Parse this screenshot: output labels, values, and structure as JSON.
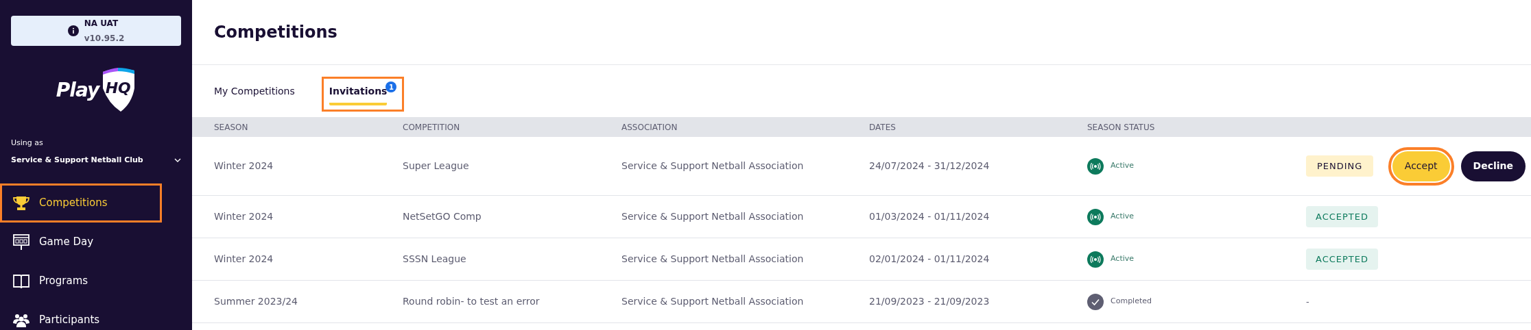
{
  "sidebar": {
    "env": {
      "name": "NA UAT",
      "version": "v10.95.2"
    },
    "logo": {
      "word": "Play",
      "mark": "HQ"
    },
    "using_as": {
      "label": "Using as",
      "org": "Service & Support Netball Club"
    },
    "items": [
      {
        "label": "Competitions",
        "selected": true,
        "highlighted": true
      },
      {
        "label": "Game Day",
        "selected": false,
        "highlighted": false
      },
      {
        "label": "Programs",
        "selected": false,
        "highlighted": false
      },
      {
        "label": "Participants",
        "selected": false,
        "highlighted": false
      }
    ]
  },
  "page": {
    "title": "Competitions"
  },
  "tabs": [
    {
      "label": "My Competitions",
      "selected": false,
      "highlighted": false
    },
    {
      "label": "Invitations",
      "selected": true,
      "highlighted": true,
      "badge": "1"
    }
  ],
  "table": {
    "columns": [
      "SEASON",
      "COMPETITION",
      "ASSOCIATION",
      "DATES",
      "SEASON STATUS"
    ],
    "rows": [
      {
        "season": "Winter 2024",
        "competition": "Super League",
        "association": "Service & Support Netball Association",
        "dates": "24/07/2024 - 31/12/2024",
        "status": {
          "kind": "active",
          "label": "Active"
        },
        "invite": {
          "kind": "pending",
          "label": "PENDING"
        },
        "actions": [
          {
            "kind": "accept",
            "label": "Accept",
            "highlighted": true
          },
          {
            "kind": "decline",
            "label": "Decline",
            "highlighted": false
          }
        ]
      },
      {
        "season": "Winter 2024",
        "competition": "NetSetGO Comp",
        "association": "Service & Support Netball Association",
        "dates": "01/03/2024 - 01/11/2024",
        "status": {
          "kind": "active",
          "label": "Active"
        },
        "invite": {
          "kind": "accepted",
          "label": "ACCEPTED"
        }
      },
      {
        "season": "Winter 2024",
        "competition": "SSSN League",
        "association": "Service & Support Netball Association",
        "dates": "02/01/2024 - 01/11/2024",
        "status": {
          "kind": "active",
          "label": "Active"
        },
        "invite": {
          "kind": "accepted",
          "label": "ACCEPTED"
        }
      },
      {
        "season": "Summer 2023/24",
        "competition": "Round robin- to test an error",
        "association": "Service & Support Netball Association",
        "dates": "21/09/2023 - 21/09/2023",
        "status": {
          "kind": "completed",
          "label": "Completed"
        },
        "invite": {
          "kind": "none",
          "label": "-"
        }
      }
    ]
  }
}
